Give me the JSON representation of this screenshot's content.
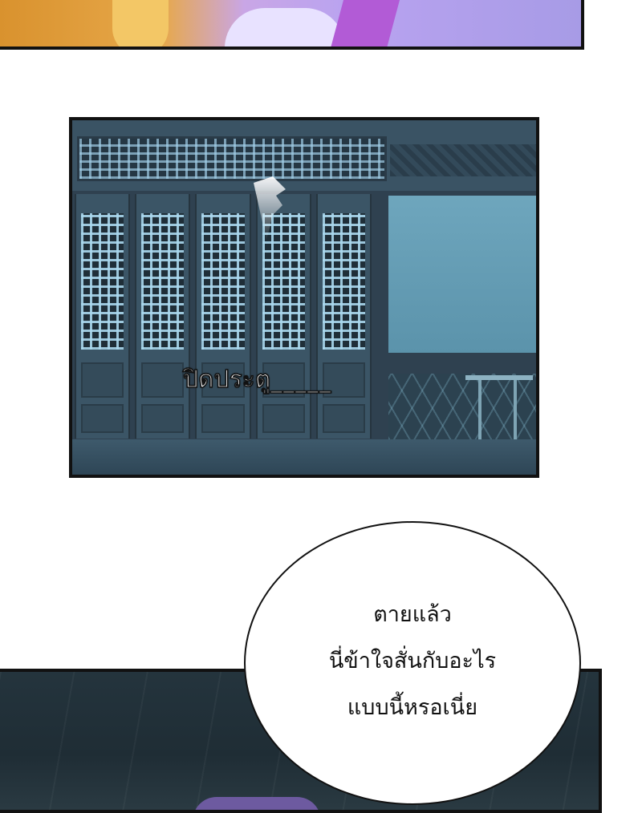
{
  "sound_effect": "ปิดประตู_____",
  "dialogue": {
    "lines": [
      "ตายแล้ว",
      "นี่ข้าใจสั่นกับอะไร",
      "แบบนี้หรอเนี่ย"
    ]
  },
  "colors": {
    "panel_border": "#111111",
    "night_wall": "#5b93ab",
    "bubble_fill": "#ffffff"
  }
}
